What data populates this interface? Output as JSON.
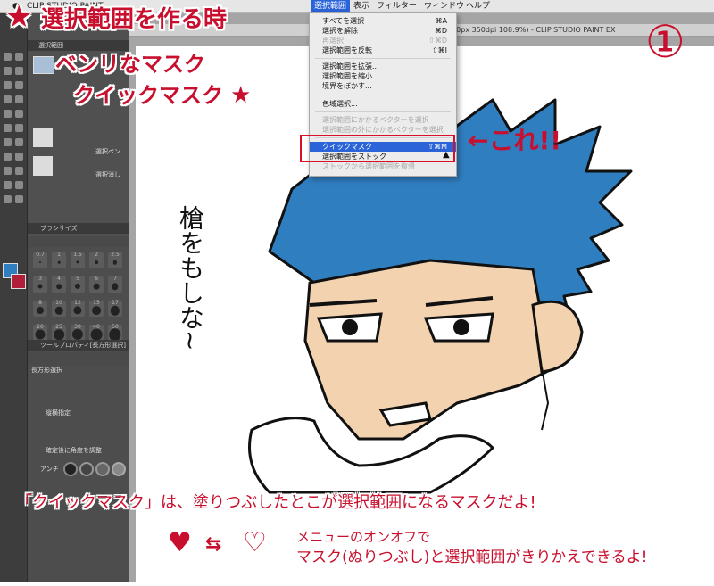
{
  "menubar": {
    "app": "CLIP STUDIO PAINT",
    "items": [
      "選択範囲",
      "表示",
      "フィルター",
      "ウィンドウ",
      "ヘルプ"
    ]
  },
  "document_title": "200px 350dpi 108.9%) - CLIP STUDIO PAINT EX",
  "subtool_panel": {
    "title": "選択範囲",
    "items": [
      "選択ペン",
      "選択消し"
    ]
  },
  "brush_size_panel": {
    "title": "ブラシサイズ",
    "values": [
      "0.7",
      "1",
      "1.5",
      "2",
      "2.5",
      "3",
      "4",
      "5",
      "6",
      "7",
      "8",
      "10",
      "12",
      "15",
      "17",
      "20",
      "25",
      "30",
      "40",
      "50"
    ]
  },
  "tool_property": {
    "title": "ツールプロパティ[長方形選択]",
    "subtitle": "長方形選択",
    "rows": [
      "縦横指定",
      "確定後に角度を調整"
    ],
    "aa_label": "アンチ"
  },
  "selection_menu": {
    "items": [
      {
        "label": "すべてを選択",
        "shortcut": "⌘A",
        "disabled": false
      },
      {
        "label": "選択を解除",
        "shortcut": "⌘D",
        "disabled": false
      },
      {
        "label": "再選択",
        "shortcut": "⇧⌘D",
        "disabled": true
      },
      {
        "label": "選択範囲を反転",
        "shortcut": "⇧⌘I",
        "disabled": false
      },
      {
        "label": "選択範囲を拡張...",
        "shortcut": "",
        "disabled": false
      },
      {
        "label": "選択範囲を縮小...",
        "shortcut": "",
        "disabled": false
      },
      {
        "label": "境界をぼかす...",
        "shortcut": "",
        "disabled": false
      },
      {
        "label": "色域選択...",
        "shortcut": "",
        "disabled": false
      },
      {
        "label": "選択範囲にかかるベクターを選択",
        "shortcut": "",
        "disabled": true
      },
      {
        "label": "選択範囲の外にかかるベクターを選択",
        "shortcut": "",
        "disabled": true
      },
      {
        "label": "クイックマスク",
        "shortcut": "⇧⌘M",
        "disabled": false,
        "highlighted": true
      },
      {
        "label": "選択範囲をストック",
        "shortcut": "",
        "disabled": false
      },
      {
        "label": "ストックから選択範囲を復帰",
        "shortcut": "",
        "disabled": true
      }
    ]
  },
  "annotations": {
    "title_line1": "選択範囲を作る時",
    "title_line2": "ベンリなマスク",
    "title_line3": "クイックマスク",
    "circled_number": "①",
    "arrow_note": "←これ!!",
    "vertical_note": "槍をもしな~",
    "caption": "「クイックマスク」は、塗りつぶしたとこが選択範囲になるマスクだよ!",
    "bottom_note_line1": "メニューのオンオフで",
    "bottom_note_line2": "マスク(ぬりつぶし)と選択範囲がきりかえできるよ!"
  },
  "colors": {
    "accent_red": "#c8102e",
    "menu_highlight": "#2b63d8",
    "hair_blue": "#2f7ec0",
    "skin": "#f3d2b0"
  }
}
